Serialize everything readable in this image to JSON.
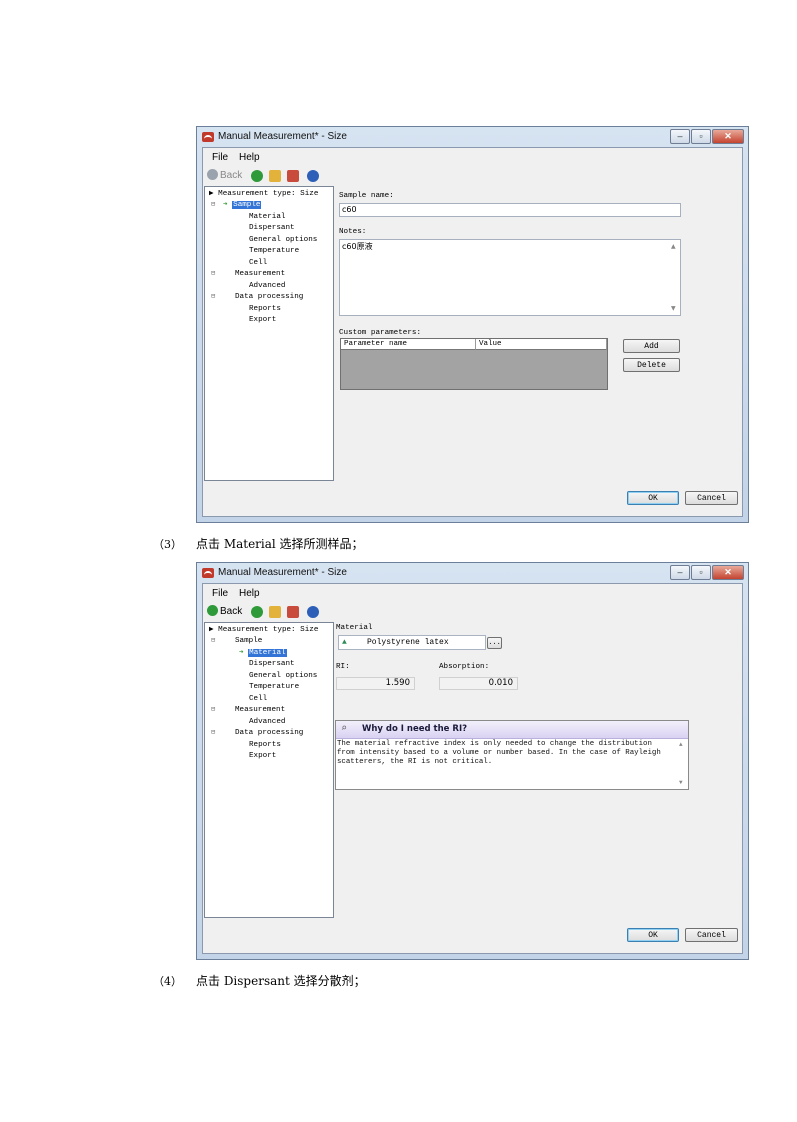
{
  "window1": {
    "title": "Manual Measurement* - Size",
    "menu": {
      "file": "File",
      "help": "Help"
    },
    "toolbar": {
      "back": "Back"
    },
    "tree": {
      "root": "Measurement type: Size",
      "items": [
        "Sample",
        "Material",
        "Dispersant",
        "General options",
        "Temperature",
        "Cell",
        "Measurement",
        "Advanced",
        "Data processing",
        "Reports",
        "Export"
      ]
    },
    "sample_name_label": "Sample name:",
    "sample_name_value": "c60",
    "notes_label": "Notes:",
    "notes_value": "c60原液",
    "custom_params_label": "Custom parameters:",
    "grid_headers": [
      "Parameter name",
      "Value"
    ],
    "add_button": "Add",
    "delete_button": "Delete",
    "ok_button": "OK",
    "cancel_button": "Cancel"
  },
  "caption3": {
    "number": "（3）",
    "text": "点击 Material 选择所测样品；"
  },
  "window2": {
    "title": "Manual Measurement* - Size",
    "menu": {
      "file": "File",
      "help": "Help"
    },
    "toolbar": {
      "back": "Back"
    },
    "tree": {
      "root": "Measurement type: Size",
      "items": [
        "Sample",
        "Material",
        "Dispersant",
        "General options",
        "Temperature",
        "Cell",
        "Measurement",
        "Advanced",
        "Data processing",
        "Reports",
        "Export"
      ]
    },
    "material_label": "Material",
    "material_value": "Polystyrene latex",
    "browse_button": "...",
    "ri_label": "RI:",
    "ri_value": "1.590",
    "absorption_label": "Absorption:",
    "absorption_value": "0.010",
    "help_title": "Why do I need the RI?",
    "help_text": "The material refractive index is only needed to change the distribution from intensity based to a volume or number based.  In the case of Rayleigh scatterers, the RI is not critical.",
    "ok_button": "OK",
    "cancel_button": "Cancel"
  },
  "caption4": {
    "number": "（4）",
    "text": "点击 Dispersant 选择分散剂；"
  },
  "colors": {
    "selection": "#3375d7",
    "titlebar": "#c3d4e8",
    "grid_body": "#a3a3a3"
  }
}
